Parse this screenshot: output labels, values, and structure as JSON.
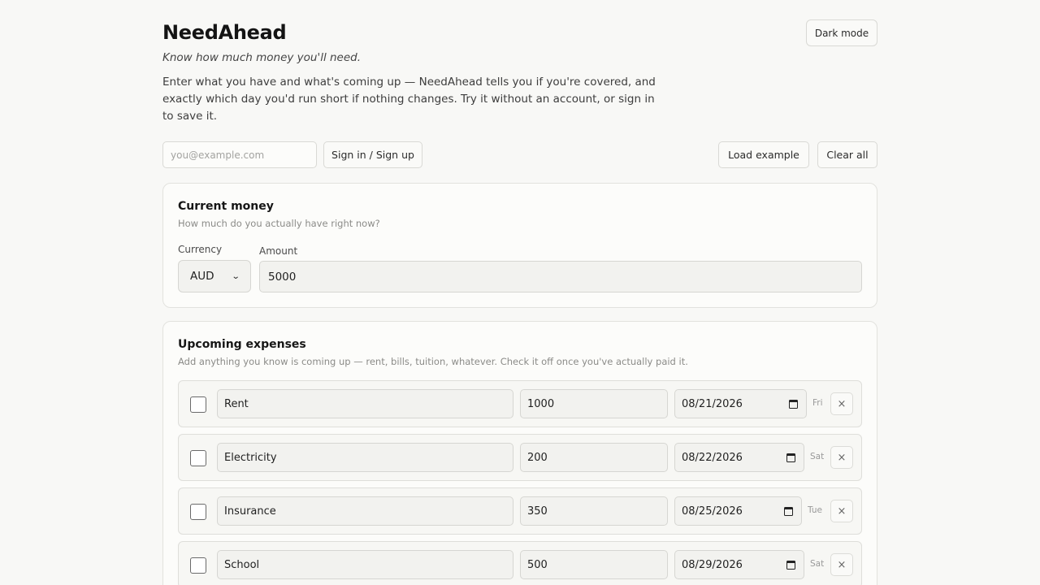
{
  "app": {
    "title": "NeedAhead",
    "tagline": "Know how much money you'll need.",
    "intro": "Enter what you have and what's coming up — NeedAhead tells you if you're covered, and exactly which day you'd run short if nothing changes. Try it without an account, or sign in to save it.",
    "dark_mode_label": "Dark mode"
  },
  "auth": {
    "email_placeholder": "you@example.com",
    "signin_label": "Sign in / Sign up"
  },
  "toolbar": {
    "load_example_label": "Load example",
    "clear_all_label": "Clear all"
  },
  "current_money": {
    "title": "Current money",
    "subtitle": "How much do you actually have right now?",
    "currency_label": "Currency",
    "currency_value": "AUD",
    "amount_label": "Amount",
    "amount_value": "5000"
  },
  "expenses": {
    "title": "Upcoming expenses",
    "subtitle": "Add anything you know is coming up — rent, bills, tuition, whatever. Check it off once you've actually paid it.",
    "items": [
      {
        "name": "Rent",
        "amount": "1000",
        "date": "08/21/2026",
        "day": "Fri",
        "paid": false
      },
      {
        "name": "Electricity",
        "amount": "200",
        "date": "08/22/2026",
        "day": "Sat",
        "paid": false
      },
      {
        "name": "Insurance",
        "amount": "350",
        "date": "08/25/2026",
        "day": "Tue",
        "paid": false
      },
      {
        "name": "School",
        "amount": "500",
        "date": "08/29/2026",
        "day": "Sat",
        "paid": false
      }
    ],
    "delete_glyph": "×"
  }
}
